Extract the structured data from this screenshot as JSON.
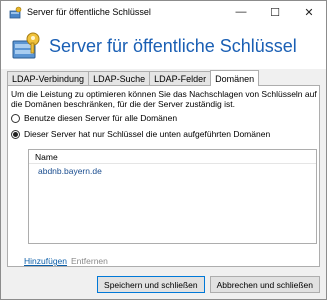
{
  "window": {
    "title": "Server für öffentliche Schlüssel",
    "controls": {
      "minimize": "—",
      "maximize": "☐",
      "close": "✕"
    }
  },
  "header": {
    "title": "Server für öffentliche Schlüssel",
    "icon": "key-server-icon"
  },
  "tabs": [
    {
      "label": "LDAP-Verbindung",
      "active": false
    },
    {
      "label": "LDAP-Suche",
      "active": false
    },
    {
      "label": "LDAP-Felder",
      "active": false
    },
    {
      "label": "Domänen",
      "active": true
    }
  ],
  "domains": {
    "description": "Um die Leistung zu optimieren können Sie das Nachschlagen von Schlüsseln auf die Domänen beschränken, für die der Server zuständig ist.",
    "option_all": "Benutze diesen Server für alle Domänen",
    "option_listed": "Dieser Server hat nur Schlüssel die unten aufgeführten Domänen",
    "selected_option": "listed",
    "list_header": "Name",
    "entries": [
      "abdnb.bayern.de"
    ],
    "add_link": "Hinzufügen",
    "remove_link": "Entfernen"
  },
  "footer": {
    "save_label": "Speichern und schließen",
    "cancel_label": "Abbrechen und schließen"
  }
}
